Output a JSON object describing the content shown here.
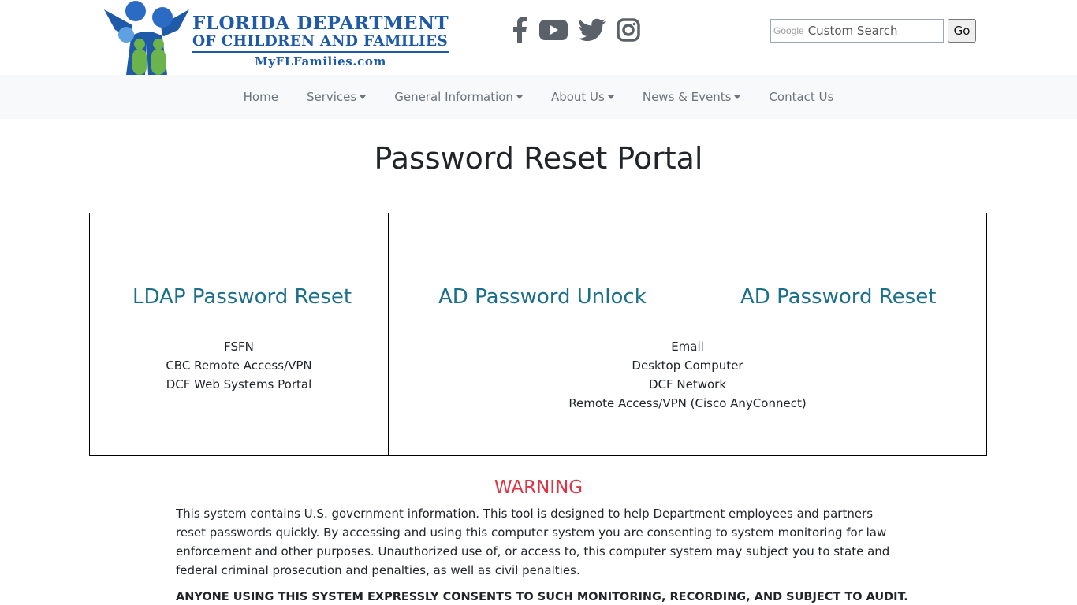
{
  "header": {
    "logo": {
      "line1": "FLORIDA DEPARTMENT",
      "line2": "OF CHILDREN AND FAMILIES",
      "line3": "MyFLFamilies.com",
      "icon": "family-figures-logo",
      "colors": {
        "blue": "#1e5aa8",
        "green": "#6bb34b"
      }
    },
    "social": [
      {
        "name": "facebook-icon"
      },
      {
        "name": "youtube-icon"
      },
      {
        "name": "twitter-icon"
      },
      {
        "name": "instagram-icon"
      }
    ],
    "search": {
      "brand": "Google",
      "placeholder": "Custom Search",
      "button_label": "Go"
    }
  },
  "nav": {
    "items": [
      {
        "label": "Home",
        "dropdown": false
      },
      {
        "label": "Services",
        "dropdown": true
      },
      {
        "label": "General Information",
        "dropdown": true
      },
      {
        "label": "About Us",
        "dropdown": true
      },
      {
        "label": "News & Events",
        "dropdown": true
      },
      {
        "label": "Contact Us",
        "dropdown": false
      }
    ]
  },
  "main": {
    "title": "Password Reset Portal",
    "ldap": {
      "link_label": "LDAP Password Reset",
      "systems": [
        "FSFN",
        "CBC Remote Access/VPN",
        "DCF Web Systems Portal"
      ]
    },
    "ad": {
      "unlock_label": "AD Password Unlock",
      "reset_label": "AD Password Reset",
      "systems": [
        "Email",
        "Desktop Computer",
        "DCF Network",
        "Remote Access/VPN (Cisco AnyConnect)"
      ]
    },
    "warning": {
      "title": "WARNING",
      "text": "This system contains U.S. government information. This tool is designed to help Department employees and partners reset passwords quickly. By accessing and using this computer system you are consenting to system monitoring for law enforcement and other purposes. Unauthorized use of, or access to, this computer system may subject you to state and federal criminal prosecution and penalties, as well as civil penalties.",
      "consent": "ANYONE USING THIS SYSTEM EXPRESSLY CONSENTS TO SUCH MONITORING, RECORDING, AND SUBJECT TO AUDIT."
    },
    "colors": {
      "link": "#1b6f8a",
      "warning": "#dc3545",
      "nav_bg": "#f8f9fa",
      "nav_text": "#6c757d"
    }
  }
}
